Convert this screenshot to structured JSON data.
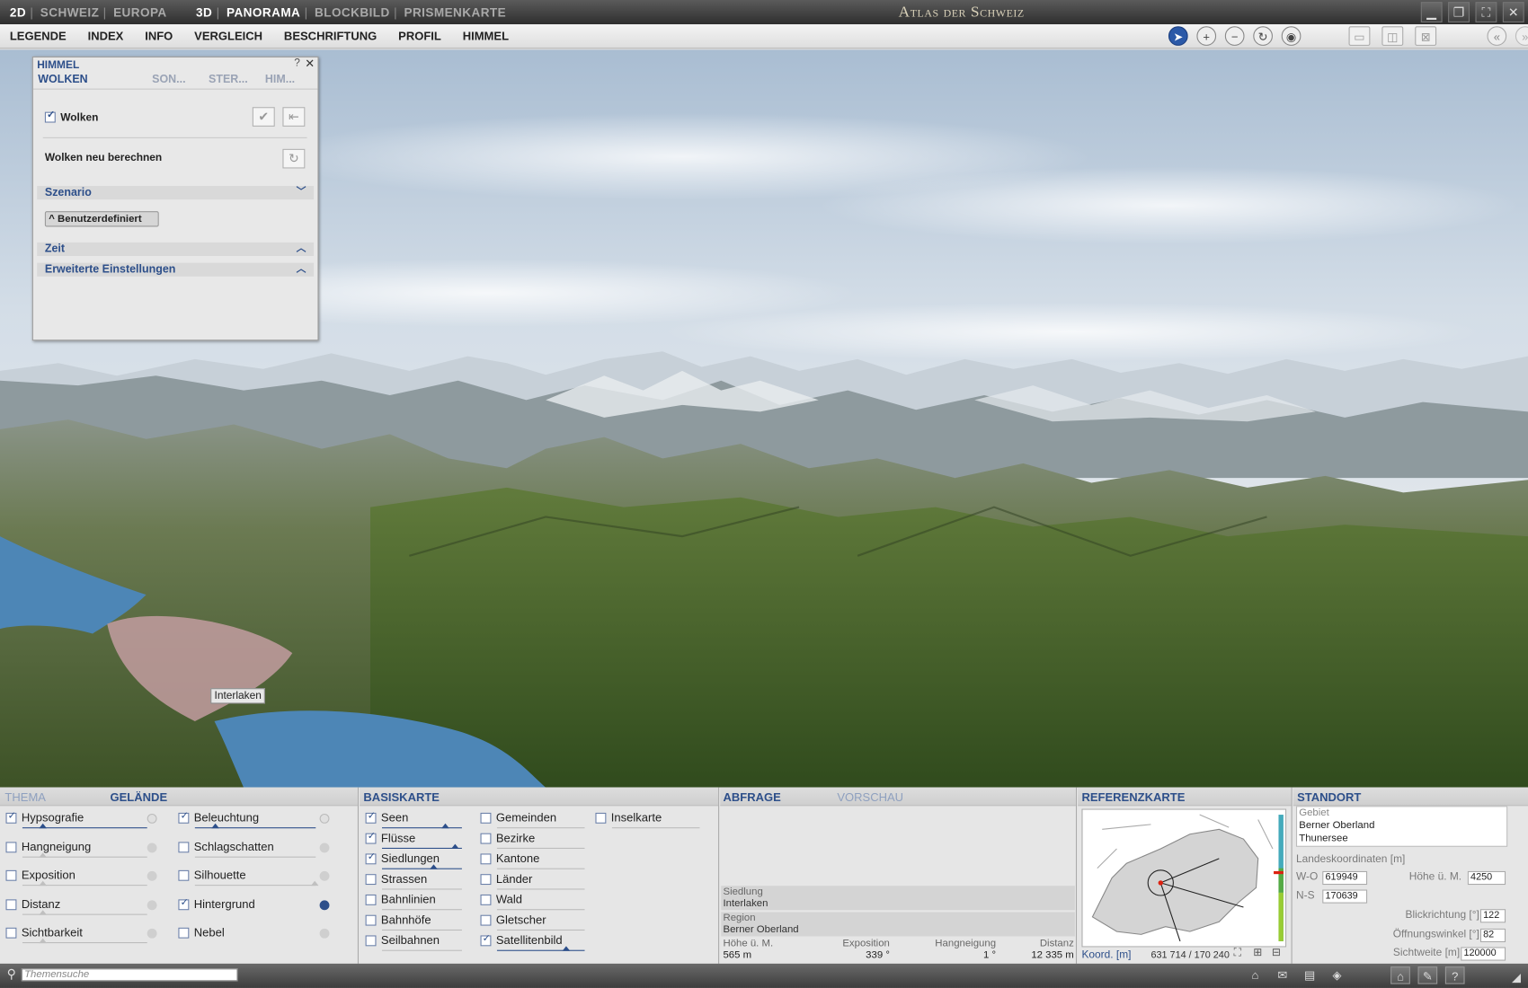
{
  "titlebar": {
    "modes": [
      "2D",
      "SCHWEIZ",
      "EUROPA",
      "3D",
      "PANORAMA",
      "BLOCKBILD",
      "PRISMENKARTE"
    ],
    "title": "Atlas der Schweiz",
    "window_buttons": [
      "minimize-icon",
      "restore-icon",
      "maximize-icon",
      "close-icon"
    ]
  },
  "menu": [
    "LEGENDE",
    "INDEX",
    "INFO",
    "VERGLEICH",
    "BESCHRIFTUNG",
    "PROFIL",
    "HIMMEL"
  ],
  "toolbar": {
    "tools": [
      "pointer-icon",
      "zoom-in-icon",
      "zoom-out-icon",
      "rotate-icon",
      "viewpoint-icon"
    ],
    "layout_tools": [
      "split-horizontal-icon",
      "split-vertical-icon",
      "no-split-icon"
    ],
    "nav_tools": [
      "collapse-left-icon",
      "collapse-right-icon"
    ]
  },
  "scene": {
    "label": "Interlaken"
  },
  "himmel_panel": {
    "title": "HIMMEL",
    "help": "?",
    "close": "✕",
    "tabs": [
      "WOLKEN",
      "SON...",
      "STER...",
      "HIM..."
    ],
    "wolken_label": "Wolken",
    "wolken_checked": true,
    "recompute_label": "Wolken neu berechnen",
    "szenario_label": "Szenario",
    "szenario_value": "Benutzerdefiniert",
    "zeit_label": "Zeit",
    "erweitert_label": "Erweiterte Einstellungen"
  },
  "bottom": {
    "thema_tab": "THEMA",
    "gelaende_tab": "GELÄNDE",
    "gelaende_left": [
      {
        "label": "Hypsografie",
        "checked": true
      },
      {
        "label": "Hangneigung",
        "checked": false
      },
      {
        "label": "Exposition",
        "checked": false
      },
      {
        "label": "Distanz",
        "checked": false
      },
      {
        "label": "Sichtbarkeit",
        "checked": false
      }
    ],
    "gelaende_right": [
      {
        "label": "Beleuchtung",
        "checked": true
      },
      {
        "label": "Schlagschatten",
        "checked": false
      },
      {
        "label": "Silhouette",
        "checked": false
      },
      {
        "label": "Hintergrund",
        "checked": true
      },
      {
        "label": "Nebel",
        "checked": false
      }
    ],
    "basiskarte_tab": "BASISKARTE",
    "basis_col1": [
      {
        "label": "Seen",
        "checked": true
      },
      {
        "label": "Flüsse",
        "checked": true
      },
      {
        "label": "Siedlungen",
        "checked": true
      },
      {
        "label": "Strassen",
        "checked": false
      },
      {
        "label": "Bahnlinien",
        "checked": false
      },
      {
        "label": "Bahnhöfe",
        "checked": false
      },
      {
        "label": "Seilbahnen",
        "checked": false
      }
    ],
    "basis_col2": [
      {
        "label": "Gemeinden",
        "checked": false
      },
      {
        "label": "Bezirke",
        "checked": false
      },
      {
        "label": "Kantone",
        "checked": false
      },
      {
        "label": "Länder",
        "checked": false
      },
      {
        "label": "Wald",
        "checked": false
      },
      {
        "label": "Gletscher",
        "checked": false
      },
      {
        "label": "Satellitenbild",
        "checked": true
      }
    ],
    "basis_col3": [
      {
        "label": "Inselkarte",
        "checked": false
      }
    ],
    "abfrage_tab": "ABFRAGE",
    "vorschau_tab": "VORSCHAU",
    "abfrage": {
      "siedlung_label": "Siedlung",
      "siedlung_value": "Interlaken",
      "region_label": "Region",
      "region_value": "Berner Oberland",
      "hoehe_label": "Höhe ü. M.",
      "hoehe_value": "565 m",
      "exposition_label": "Exposition",
      "exposition_value": "339 °",
      "hangneigung_label": "Hangneigung",
      "hangneigung_value": "1 °",
      "distanz_label": "Distanz",
      "distanz_value": "12 335 m"
    },
    "referenz_tab": "REFERENZKARTE",
    "referenz": {
      "koord_label": "Koord. [m]",
      "koord_value": "631 714 / 170 240"
    },
    "standort_tab": "STANDORT",
    "standort": {
      "gebiet_label": "Gebiet",
      "gebiet_lines": [
        "Berner Oberland",
        "Thunersee"
      ],
      "landeskoord_label": "Landeskoordinaten [m]",
      "wo_label": "W-O",
      "wo_value": "619949",
      "ns_label": "N-S",
      "ns_value": "170639",
      "hoehe_label": "Höhe ü. M.",
      "hoehe_value": "4250",
      "blickrichtung_label": "Blickrichtung [°]",
      "blickrichtung_value": "122",
      "oeffnung_label": "Öffnungswinkel [°]",
      "oeffnung_value": "82",
      "sichtweite_label": "Sichtweite [m]",
      "sichtweite_value": "120000"
    }
  },
  "statusbar": {
    "search_placeholder": "Themensuche",
    "icons": [
      "home-icon",
      "bookmark-icon",
      "print-icon",
      "layers-icon",
      "house-icon",
      "tools-icon",
      "help-icon"
    ]
  },
  "colors": {
    "accent": "#2d4f8a",
    "sky": "#c9d6e3",
    "lake": "#4d86b6"
  }
}
